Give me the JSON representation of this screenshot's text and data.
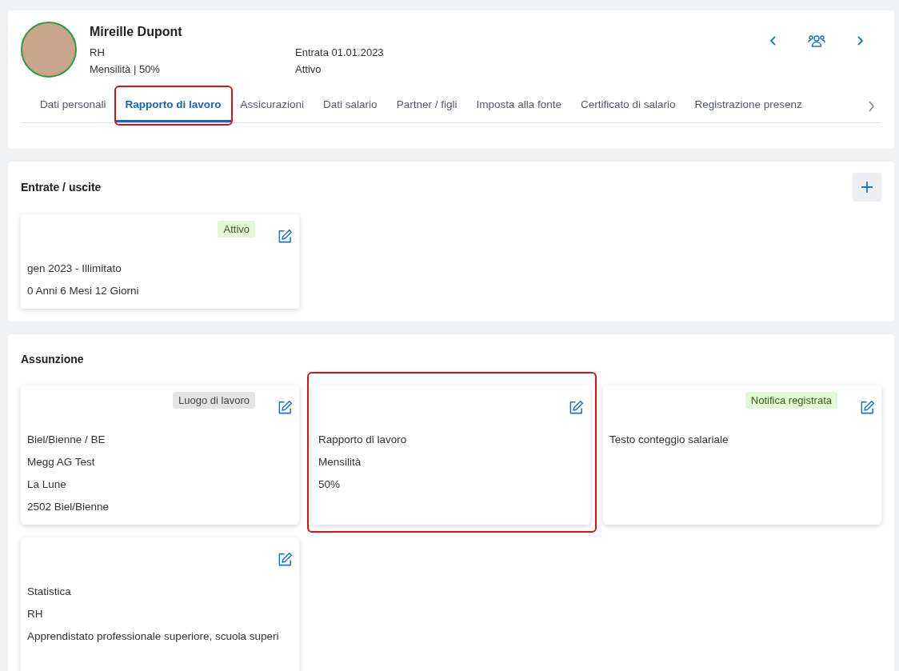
{
  "employee": {
    "name": "Mireille Dupont",
    "department": "RH",
    "pay": "Mensilità | 50%",
    "entry": "Entrata 01.01.2023",
    "status": "Attivo"
  },
  "tabs": [
    {
      "label": "Dati personali",
      "selected": false,
      "highlighted": false
    },
    {
      "label": "Rapporto di lavoro",
      "selected": true,
      "highlighted": true
    },
    {
      "label": "Assicurazioni",
      "selected": false,
      "highlighted": false
    },
    {
      "label": "Dati salario",
      "selected": false,
      "highlighted": false
    },
    {
      "label": "Partner / figli",
      "selected": false,
      "highlighted": false
    },
    {
      "label": "Imposta alla fonte",
      "selected": false,
      "highlighted": false
    },
    {
      "label": "Certificato di salario",
      "selected": false,
      "highlighted": false
    },
    {
      "label": "Registrazione presenz",
      "selected": false,
      "highlighted": false
    }
  ],
  "sections": [
    {
      "title": "Entrate / uscite",
      "add_button": true,
      "cards": [
        {
          "badge": {
            "label": "Attivo",
            "kind": "success"
          },
          "lines": [
            "gen 2023 - Illimitato",
            "0 Anni 6 Mesi 12 Giorni"
          ],
          "highlighted": false
        }
      ]
    },
    {
      "title": "Assunzione",
      "add_button": false,
      "cards": [
        {
          "badge": {
            "label": "Luogo di lavoro",
            "kind": "neutral"
          },
          "lines": [
            "Biel/Bienne / BE",
            "Megg AG Test",
            "La Lune",
            "2502 Biel/Bienne"
          ],
          "highlighted": false
        },
        {
          "lines": [
            "Rapporto di lavoro",
            "Mensilità",
            "50%"
          ],
          "highlighted": true
        },
        {
          "badge": {
            "label": "Notifica registrata",
            "kind": "success"
          },
          "lines": [
            "Testo conteggio salariale"
          ],
          "highlighted": false
        },
        {
          "lines": [
            "Statistica",
            "RH",
            "Apprendistato professionale superiore, scuola superi"
          ],
          "highlighted": false
        }
      ]
    }
  ]
}
